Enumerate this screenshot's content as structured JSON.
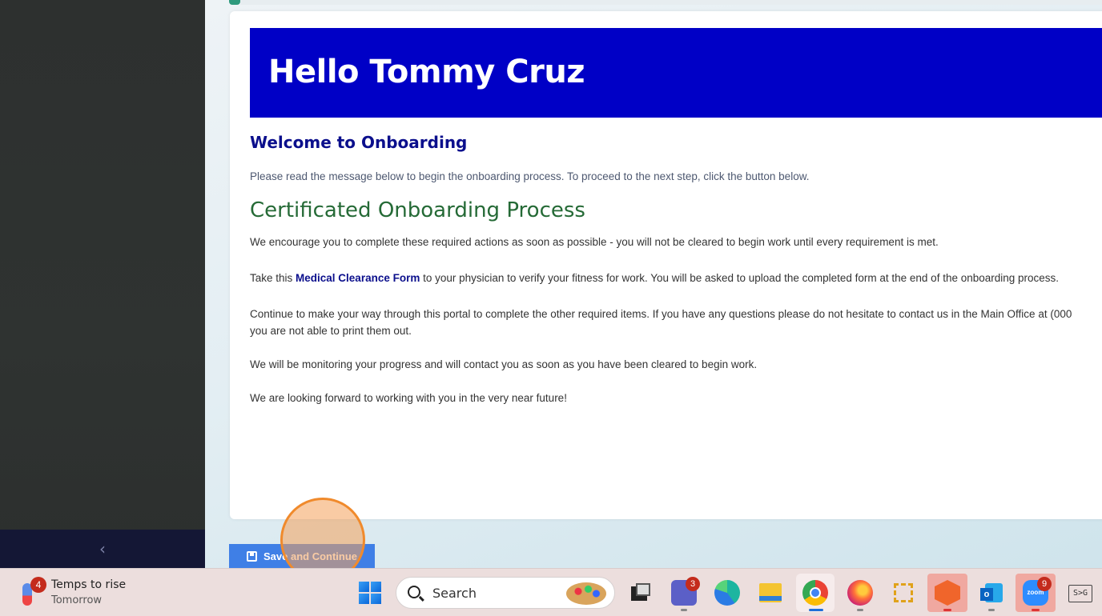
{
  "sidebar": {
    "collapse_icon": "chevron-left-icon",
    "collapse_glyph": "‹"
  },
  "header": {
    "greeting": "Hello Tommy Cruz"
  },
  "content": {
    "welcome_title": "Welcome to Onboarding",
    "intro": "Please read the message below to begin the onboarding process. To proceed to the next step, click the button below.",
    "process_title": "Certificated Onboarding Process",
    "p1": "We encourage you to complete these required actions as soon as possible - you will not be cleared to begin work until every requirement is met.",
    "p2_before": "Take this ",
    "p2_link": "Medical Clearance Form",
    "p2_after": " to your physician to verify your fitness for work. You will be asked to upload the completed form at the end of the onboarding process.",
    "p3_line1": "Continue to make your way through this portal to complete the other required items. If you have any questions please do not hesitate to contact us in the Main Office at (000",
    "p3_line2": "you are not able to print them out.",
    "p4": "We will be monitoring your progress and will contact you as soon as you have been cleared to begin work.",
    "p5": "We are looking forward to working with you in the very near future!"
  },
  "actions": {
    "save_label": "Save and Continue",
    "save_icon": "floppy-disk-icon"
  },
  "taskbar": {
    "weather_badge": "4",
    "weather_title": "Temps to rise",
    "weather_sub": "Tomorrow",
    "search_label": "Search",
    "teams_badge": "3",
    "zoom_badge": "9",
    "zoom_label": "zoom",
    "ime_label": "S>G",
    "icons": [
      "windows-start-icon",
      "task-view-icon",
      "teams-icon",
      "edge-icon",
      "file-explorer-icon",
      "chrome-icon",
      "firefox-icon",
      "snip-tool-icon",
      "vpn-icon",
      "outlook-icon",
      "zoom-icon",
      "ime-icon"
    ]
  },
  "colors": {
    "hero": "#0000c6",
    "welcome": "#0b0f8c",
    "process_title": "#256a36",
    "button": "#3f7fe6",
    "click_marker": "#f08a2c"
  }
}
